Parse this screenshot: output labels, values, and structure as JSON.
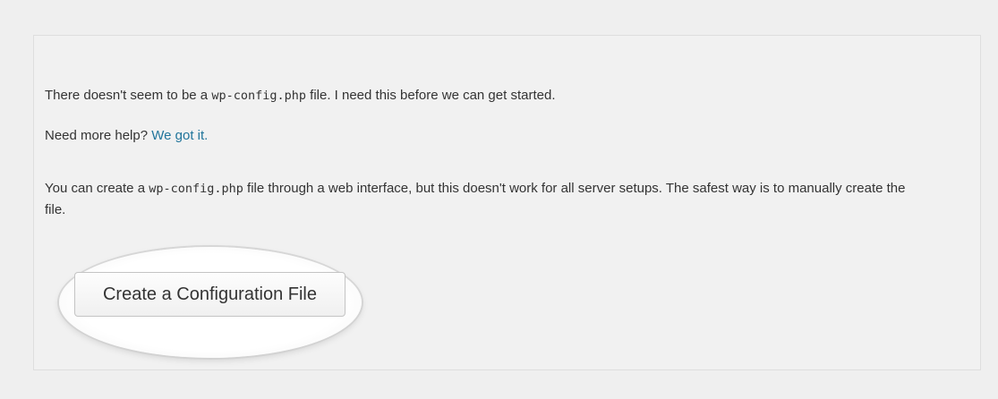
{
  "setup": {
    "missing_prefix": "There doesn't seem to be a ",
    "missing_file": "wp-config.php",
    "missing_suffix": " file. I need this before we can get started.",
    "help_prefix": "Need more help? ",
    "help_link": "We got it.",
    "create_prefix": "You can create a ",
    "create_file": "wp-config.php",
    "create_suffix": " file through a web interface, but this doesn't work for all server setups. The safest way is to manually create the file.",
    "button_label": "Create a Configuration File"
  },
  "colors": {
    "link": "#21759b",
    "panel_background": "#f1f1f1",
    "page_background": "#efefef"
  }
}
